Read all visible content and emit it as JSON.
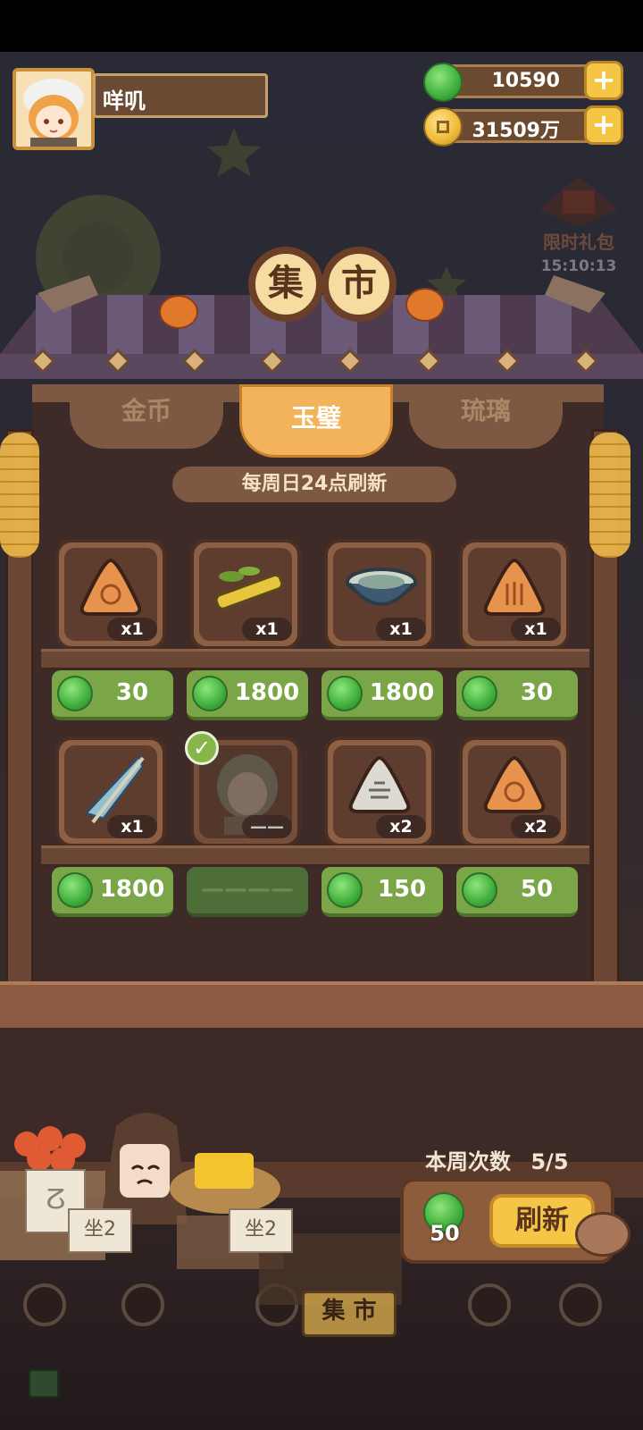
{
  "player": {
    "name": "咩叽"
  },
  "currencies": {
    "jade": "10590",
    "coins": "31509万"
  },
  "gift": {
    "label": "限时礼包",
    "timer": "15:10:13"
  },
  "title": {
    "char1": "集",
    "char2": "市"
  },
  "tabs": [
    {
      "label": "金币"
    },
    {
      "label": "玉璧"
    },
    {
      "label": "琉璃"
    }
  ],
  "refresh_note": "每周日24点刷新",
  "items": [
    {
      "name": "orange-triangle-token",
      "qty": "x1",
      "price": "30"
    },
    {
      "name": "bamboo-branch",
      "qty": "x1",
      "price": "1800"
    },
    {
      "name": "porcelain-bowl",
      "qty": "x1",
      "price": "1800"
    },
    {
      "name": "orange-triangle-token-2",
      "qty": "x1",
      "price": "30"
    },
    {
      "name": "paper-umbrella",
      "qty": "x1",
      "price": "1800"
    },
    {
      "name": "character-portrait",
      "qty": "——",
      "price": "————"
    },
    {
      "name": "white-triangle-token",
      "qty": "x2",
      "price": "150"
    },
    {
      "name": "orange-triangle-token-3",
      "qty": "x2",
      "price": "50"
    }
  ],
  "weekly": {
    "label": "本周次数",
    "count": "5/5"
  },
  "refresh": {
    "cost": "50",
    "label": "刷新"
  },
  "stall_signs": {
    "left": "坐2",
    "right": "坐2",
    "market": "集 市"
  },
  "colors": {
    "jade": "#3fae3b",
    "price_bg": "#7aa648",
    "gold_button": "#f5c646"
  }
}
